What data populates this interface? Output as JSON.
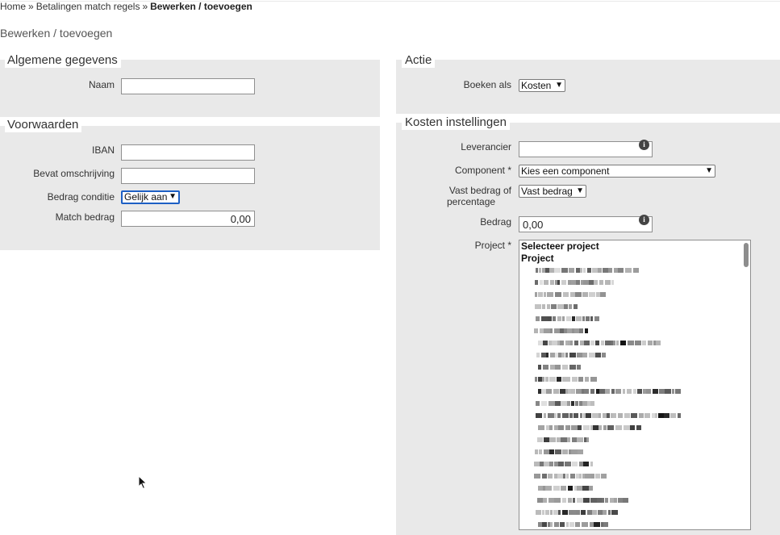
{
  "breadcrumb": {
    "home": "Home",
    "separator": "»",
    "rules": "Betalingen match regels",
    "current": "Bewerken / toevoegen"
  },
  "page_title": "Bewerken / toevoegen",
  "general": {
    "legend": "Algemene gegevens",
    "name_label": "Naam",
    "name_value": ""
  },
  "conditions": {
    "legend": "Voorwaarden",
    "iban_label": "IBAN",
    "iban_value": "",
    "description_label": "Bevat omschrijving",
    "description_value": "",
    "amount_condition_label": "Bedrag conditie",
    "amount_condition_value": "Gelijk aan",
    "match_amount_label": "Match bedrag",
    "match_amount_value": "0,00"
  },
  "action": {
    "legend": "Actie",
    "book_as_label": "Boeken als",
    "book_as_value": "Kosten"
  },
  "cost_settings": {
    "legend": "Kosten instellingen",
    "supplier_label": "Leverancier",
    "supplier_value": "",
    "component_label": "Component *",
    "component_value": "Kies een component",
    "fixed_or_pct_label_1": "Vast bedrag of",
    "fixed_or_pct_label_2": "percentage",
    "fixed_or_pct_value": "Vast bedrag",
    "amount_label": "Bedrag",
    "amount_value": "0,00",
    "project_label": "Project *",
    "project_options": [
      "Selecteer project",
      "Project"
    ],
    "blurred_rows": 22
  },
  "icons": {
    "info": "info-icon",
    "chevron": "chevron-down-icon",
    "cursor": "mouse-pointer-icon"
  },
  "colors": {
    "panel_bg": "#e9e9e9",
    "focus_border": "#1d5fc4"
  }
}
